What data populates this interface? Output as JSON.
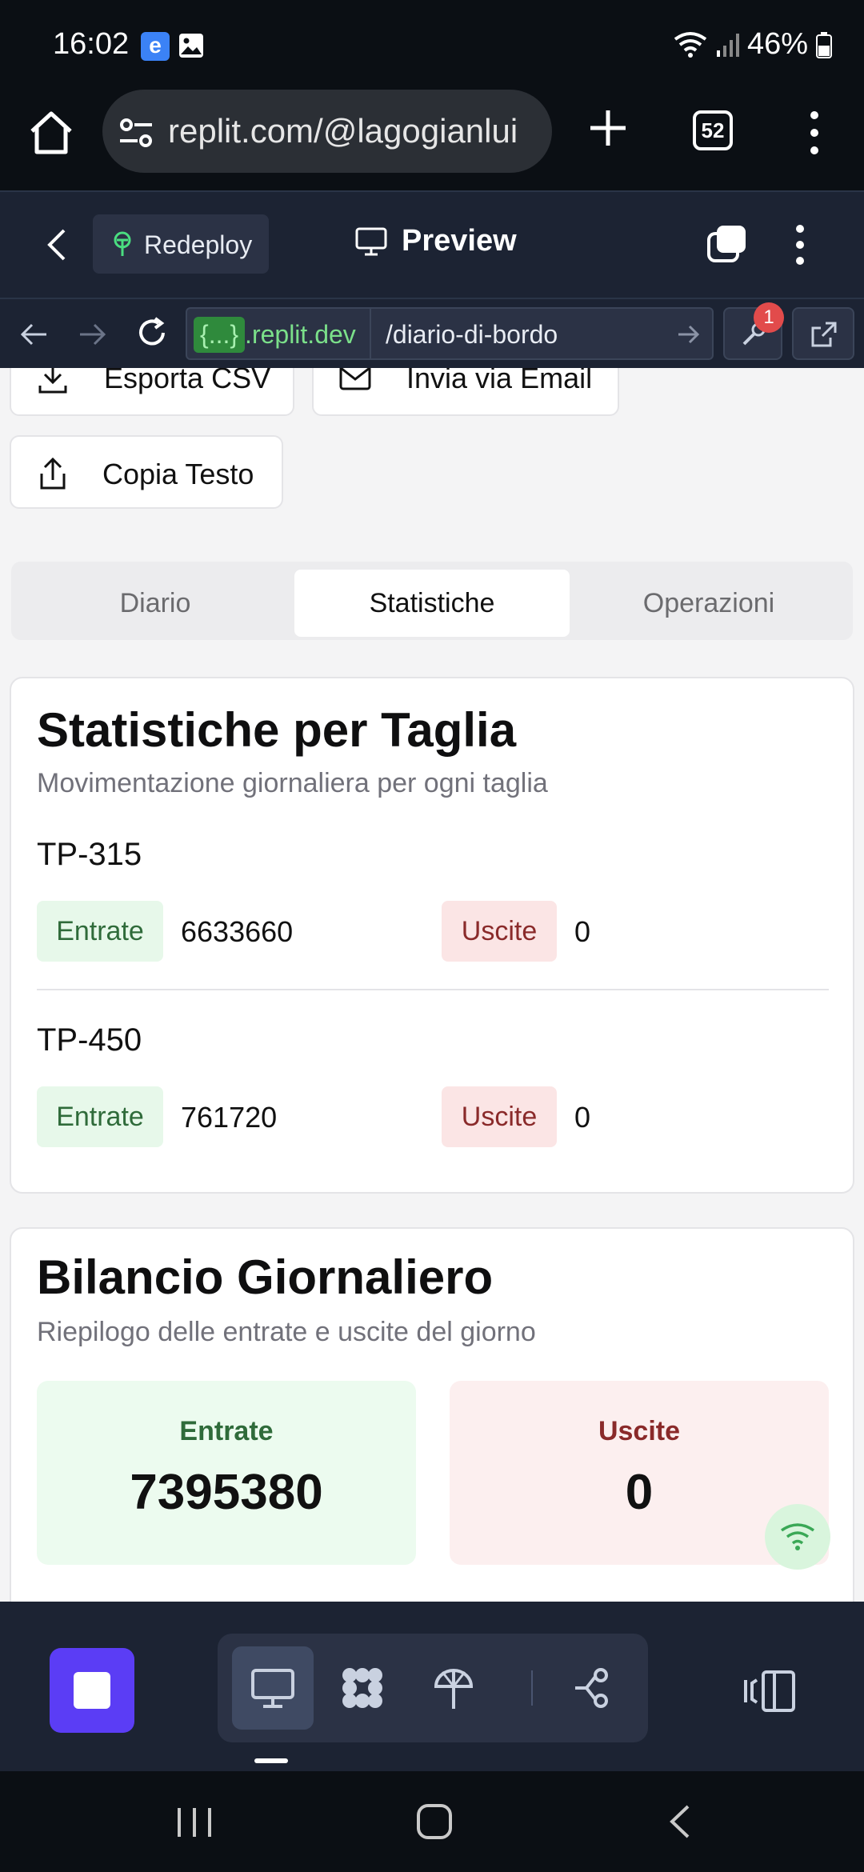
{
  "status_bar": {
    "time": "16:02",
    "battery": "46%"
  },
  "browser": {
    "url": "replit.com/@lagogianlui",
    "tab_count": "52"
  },
  "replit_header": {
    "redeploy_label": "Redeploy",
    "preview_label": "Preview"
  },
  "dev_url": {
    "domain_prefix": "{...}",
    "domain": ".replit.dev",
    "path": "/diario-di-bordo",
    "notification_count": "1"
  },
  "actions": {
    "export_csv": "Esporta CSV",
    "send_email": "Invia via Email",
    "copy_text": "Copia Testo"
  },
  "tabs": [
    {
      "label": "Diario",
      "active": false
    },
    {
      "label": "Statistiche",
      "active": true
    },
    {
      "label": "Operazioni",
      "active": false
    }
  ],
  "stats_card": {
    "title": "Statistiche per Taglia",
    "subtitle": "Movimentazione giornaliera per ogni taglia",
    "sizes": [
      {
        "name": "TP-315",
        "in_label": "Entrate",
        "in_value": "6633660",
        "out_label": "Uscite",
        "out_value": "0"
      },
      {
        "name": "TP-450",
        "in_label": "Entrate",
        "in_value": "761720",
        "out_label": "Uscite",
        "out_value": "0"
      }
    ]
  },
  "balance_card": {
    "title": "Bilancio Giornaliero",
    "subtitle": "Riepilogo delle entrate e uscite del giorno",
    "in_label": "Entrate",
    "in_value": "7395380",
    "out_label": "Uscite",
    "out_value": "0"
  },
  "colors": {
    "accent_purple": "#5b3df5",
    "in_bg": "#e7f8ea",
    "in_text": "#2f6b3a",
    "out_bg": "#fbe5e5",
    "out_text": "#8a2a2a"
  }
}
